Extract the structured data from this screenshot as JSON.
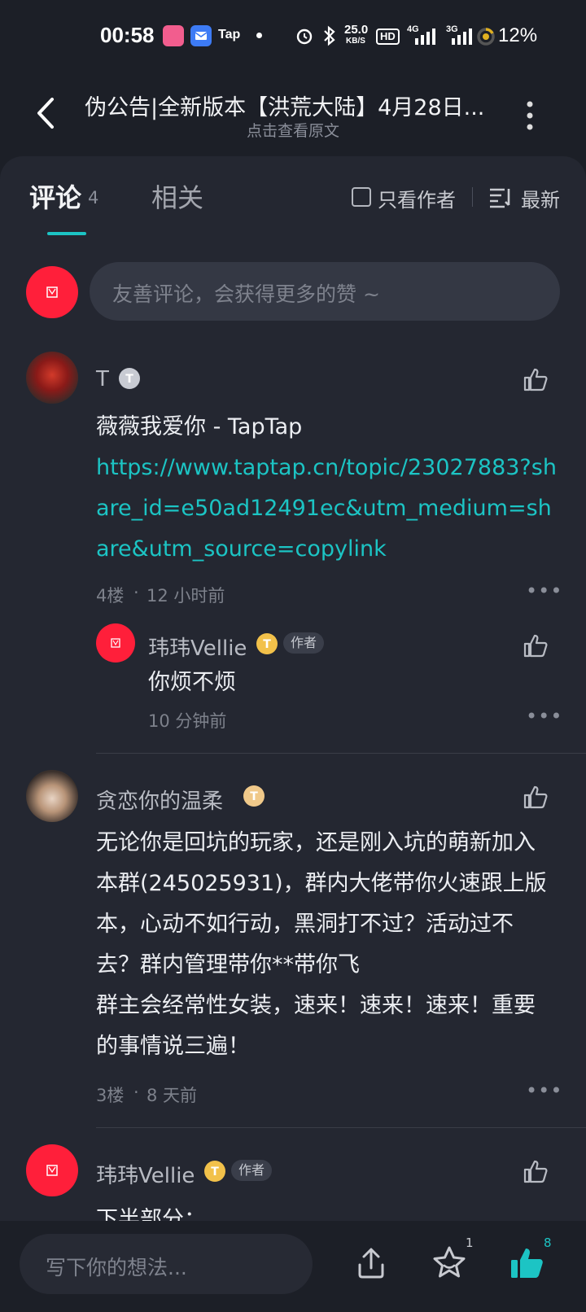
{
  "status_bar": {
    "time": "00:58",
    "app_tap": "Tap",
    "net_speed_value": "25.0",
    "net_speed_unit": "KB/S",
    "hd": "HD",
    "sig1": "4G",
    "sig2": "3G",
    "battery": "12%"
  },
  "header": {
    "title": "伪公告|全新版本【洪荒大陆】4月28日...",
    "subtitle": "点击查看原文"
  },
  "tabs": {
    "comments_label": "评论",
    "comments_count": "4",
    "related_label": "相关"
  },
  "filters": {
    "author_only": "只看作者",
    "sort": "最新"
  },
  "comment_input": {
    "placeholder": "友善评论，会获得更多的赞 ~"
  },
  "comments": [
    {
      "user": "T",
      "text": "薇薇我爱你 - TapTap",
      "link": "https://www.taptap.cn/topic/23027883?share_id=e50ad12491ec&utm_medium=share&utm_source=copylink",
      "floor": "4楼",
      "time": "12 小时前",
      "reply": {
        "user": "玮玮Vellie",
        "author_tag": "作者",
        "text": "你烦不烦",
        "time": "10 分钟前"
      }
    },
    {
      "user": "贪恋你的温柔",
      "lines": [
        "无论你是回坑的玩家，还是刚入坑的萌新加入",
        "本群(245025931)，群内大佬带你火速跟上版",
        "本，心动不如行动，黑洞打不过？活动过不",
        "去？群内管理带你**带你飞",
        "群主会经常性女装，速来！速来！速来！重要",
        "的事情说三遍！"
      ],
      "floor": "3楼",
      "time": "8 天前"
    },
    {
      "user": "玮玮Vellie",
      "author_tag": "作者",
      "text": "下半部分："
    }
  ],
  "meta_sep": "·",
  "bottom_bar": {
    "placeholder": "写下你的想法...",
    "star_count": "1",
    "like_count": "8"
  },
  "colors": {
    "accent": "#1cc4c4",
    "background": "#1c1f27",
    "sheet": "#242731",
    "avatar_red": "#ff1f3a"
  }
}
